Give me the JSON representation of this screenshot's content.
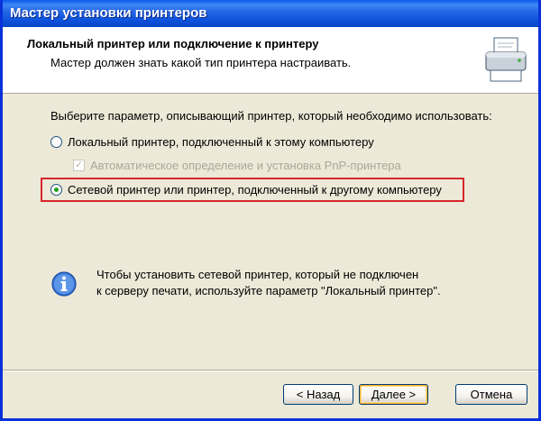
{
  "window": {
    "title": "Мастер установки принтеров"
  },
  "header": {
    "title": "Локальный принтер или подключение к принтеру",
    "subtitle": "Мастер должен знать какой тип принтера настраивать.",
    "icon": "printer-icon"
  },
  "content": {
    "prompt": "Выберите параметр, описывающий принтер, который необходимо использовать:",
    "options": [
      {
        "label": "Локальный принтер, подключенный к этому компьютеру",
        "selected": false
      },
      {
        "label": "Сетевой принтер или принтер, подключенный к другому компьютеру",
        "selected": true
      }
    ],
    "pnp_checkbox": {
      "label": "Автоматическое определение и установка PnP-принтера",
      "checked": true,
      "enabled": false
    },
    "info": {
      "icon": "info-icon",
      "line1": "Чтобы установить сетевой принтер, который не подключен",
      "line2": "к серверу печати, используйте параметр \"Локальный принтер\"."
    }
  },
  "buttons": {
    "back": "< Назад",
    "next": "Далее >",
    "cancel": "Отмена"
  },
  "colors": {
    "titlebar": "#0A46C4",
    "highlight": "#D8262B",
    "radio_dot": "#21A121"
  }
}
